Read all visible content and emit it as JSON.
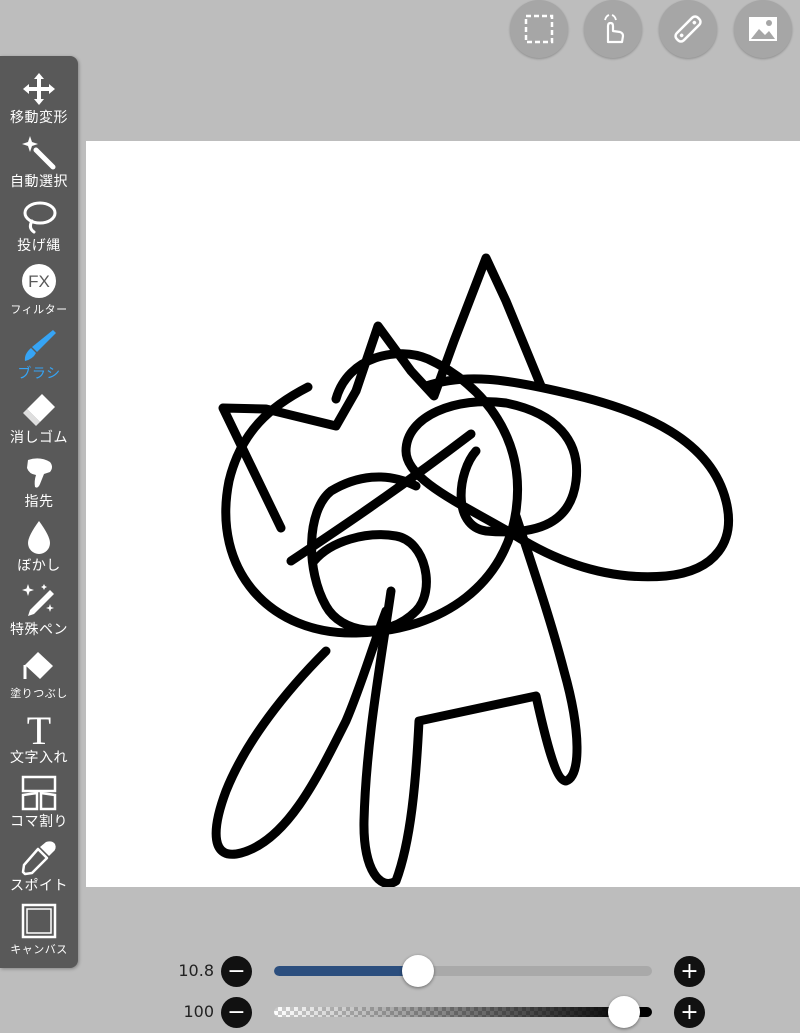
{
  "top_buttons": [
    {
      "icon": "selection-rect-icon"
    },
    {
      "icon": "hand-touch-icon"
    },
    {
      "icon": "ruler-icon"
    },
    {
      "icon": "image-icon"
    }
  ],
  "tools": [
    {
      "id": "move-transform",
      "label": "移動変形",
      "icon": "move-arrows-icon"
    },
    {
      "id": "auto-select",
      "label": "自動選択",
      "icon": "magic-wand-icon"
    },
    {
      "id": "lasso",
      "label": "投げ縄",
      "icon": "lasso-icon"
    },
    {
      "id": "filter",
      "label": "フィルター",
      "icon": "fx-icon",
      "icon_text": "FX"
    },
    {
      "id": "brush",
      "label": "ブラシ",
      "icon": "brush-icon",
      "active": true
    },
    {
      "id": "eraser",
      "label": "消しゴム",
      "icon": "eraser-icon"
    },
    {
      "id": "finger",
      "label": "指先",
      "icon": "finger-icon"
    },
    {
      "id": "blur",
      "label": "ぼかし",
      "icon": "drop-icon"
    },
    {
      "id": "special-pen",
      "label": "特殊ペン",
      "icon": "sparkle-pen-icon"
    },
    {
      "id": "fill",
      "label": "塗りつぶし",
      "icon": "bucket-icon"
    },
    {
      "id": "text",
      "label": "文字入れ",
      "icon": "text-t-icon",
      "icon_text": "T"
    },
    {
      "id": "frame-divide",
      "label": "コマ割り",
      "icon": "panels-icon"
    },
    {
      "id": "eyedropper",
      "label": "スポイト",
      "icon": "eyedropper-icon"
    },
    {
      "id": "canvas",
      "label": "キャンバス",
      "icon": "canvas-icon"
    }
  ],
  "brush_size": {
    "value_label": "10.8",
    "fraction": 0.36
  },
  "brush_opacity": {
    "value_label": "100",
    "fraction": 1.0
  },
  "colors": {
    "accent": "#36a4f5",
    "size_fill": "#2b4e7e",
    "toolbar": "#595959",
    "background": "#bdbdbd"
  }
}
